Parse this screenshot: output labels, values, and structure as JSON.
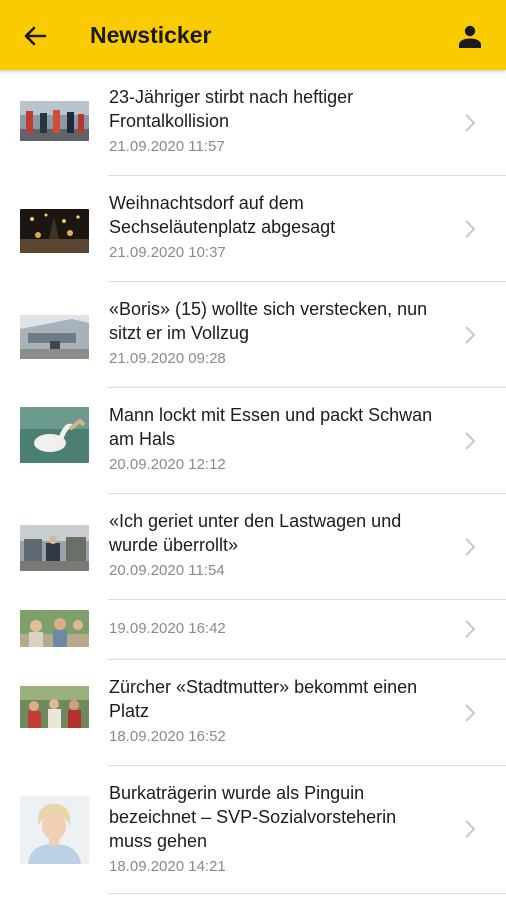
{
  "header": {
    "title": "Newsticker",
    "back_icon": "arrow-left-icon",
    "user_icon": "person-icon",
    "accent_color": "#f9cb00"
  },
  "items": [
    {
      "headline": "23-Jähriger stirbt nach heftiger Frontalkollision",
      "date": "21.09.2020 11:57"
    },
    {
      "headline": "Weihnachtsdorf auf dem Sechseläutenplatz abgesagt",
      "date": "21.09.2020 10:37"
    },
    {
      "headline": "«Boris» (15) wollte sich verstecken, nun sitzt er im Vollzug",
      "date": "21.09.2020 09:28"
    },
    {
      "headline": "Mann lockt mit Essen und packt Schwan am Hals",
      "date": "20.09.2020 12:12"
    },
    {
      "headline": "«Ich geriet unter den Lastwagen und wurde überrollt»",
      "date": "20.09.2020 11:54"
    },
    {
      "headline": "",
      "date": "19.09.2020 16:42"
    },
    {
      "headline": "Zürcher «Stadtmutter» bekommt einen Platz",
      "date": "18.09.2020 16:52"
    },
    {
      "headline": "Burkaträgerin wurde als Pinguin bezeichnet – SVP-Sozialvorsteherin muss gehen",
      "date": "18.09.2020 14:21"
    }
  ],
  "chevron_icon": "chevron-right-icon"
}
